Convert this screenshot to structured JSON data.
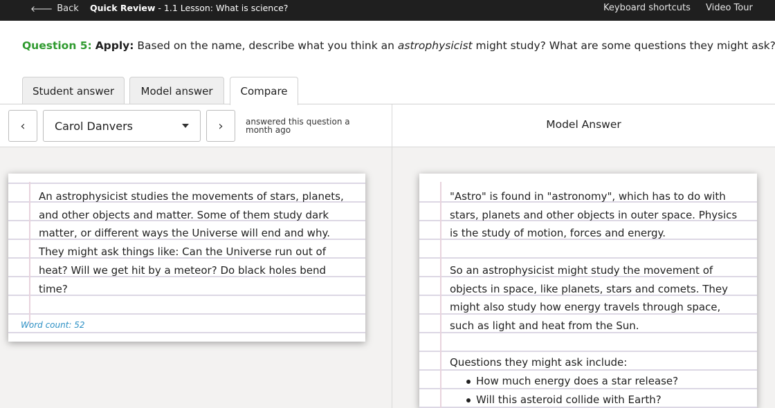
{
  "topbar": {
    "back_label": "Back",
    "breadcrumb_bold": "Quick Review",
    "breadcrumb_rest": " - 1.1 Lesson: What is science?",
    "keyboard_shortcuts": "Keyboard shortcuts",
    "video_tour": "Video Tour"
  },
  "question": {
    "label": "Question 5:",
    "type": "Apply:",
    "text_before": " Based on the name, describe what you think an ",
    "text_italic": "astrophysicist",
    "text_after": " might study? What are some questions they might ask?"
  },
  "tabs": [
    {
      "label": "Student answer",
      "active": false
    },
    {
      "label": "Model answer",
      "active": false
    },
    {
      "label": "Compare",
      "active": true
    }
  ],
  "compare": {
    "prev_icon": "‹",
    "next_icon": "›",
    "selected_student": "Carol Danvers",
    "answered_text": "answered this question a month ago",
    "model_title": "Model Answer"
  },
  "student_answer": {
    "text": "An astrophysicist studies the movements of stars, planets, and other objects and matter. Some of them study dark matter, or different ways the Universe will end and why. They might ask things like: Can the Universe run out of heat? Will we get hit by a meteor? Do black holes bend time?",
    "word_count_label": "Word count: 52"
  },
  "model_answer": {
    "para1": "\"Astro\" is found in \"astronomy\", which has to do with stars, planets and other objects in outer space. Physics is the study of motion, forces and energy.",
    "para2": "So an astrophysicist might study the movement of objects in space, like planets, stars and comets. They might also study how energy travels through space, such as light and heat from the Sun.",
    "para3": "Questions they might ask include:",
    "bullets": [
      "How much energy does a star release?",
      "Will this asteroid collide with Earth?"
    ]
  },
  "colors": {
    "topbar_bg": "#1f1f1f",
    "question_label": "#2e9a2e",
    "word_count": "#2a8fc4",
    "panel_bg": "#f3f2f1"
  }
}
